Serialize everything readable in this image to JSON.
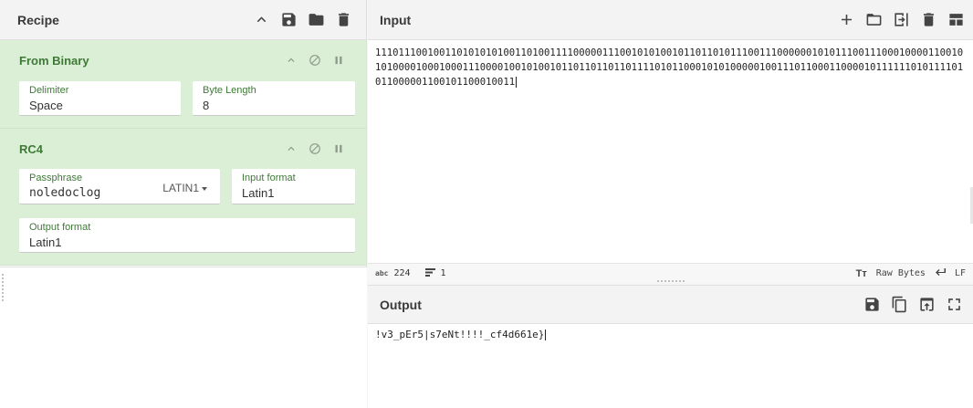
{
  "recipe": {
    "title": "Recipe",
    "header_icons": [
      "chevron-up-icon",
      "save-icon",
      "folder-icon",
      "trash-icon"
    ],
    "operations": [
      {
        "name": "From Binary",
        "controls": [
          "chevron-up-icon",
          "disable-icon",
          "pause-icon"
        ],
        "fields": [
          {
            "label": "Delimiter",
            "value": "Space"
          },
          {
            "label": "Byte Length",
            "value": "8"
          }
        ]
      },
      {
        "name": "RC4",
        "controls": [
          "chevron-up-icon",
          "disable-icon",
          "pause-icon"
        ],
        "fields": [
          {
            "label": "Passphrase",
            "value": "noledoclog",
            "dropdown": "LATIN1"
          },
          {
            "label": "Input format",
            "value": "Latin1"
          },
          {
            "label": "Output format",
            "value": "Latin1"
          }
        ]
      }
    ]
  },
  "input": {
    "title": "Input",
    "header_icons": [
      "plus-icon",
      "folder-icon",
      "import-icon",
      "trash-icon",
      "layout-icon"
    ],
    "text": "1110111001001101010101001101001111000001110010101001011011010111001110000001010111001110001000011001010100001000100011100001001010010110110110110111101011000101010000010011101100011000010111111010111101011000001100101100010011",
    "status": {
      "length_icon": "abc",
      "length": "224",
      "lines": "1",
      "raw_bytes": "Raw Bytes",
      "eol": "LF"
    }
  },
  "output": {
    "title": "Output",
    "header_icons": [
      "save-icon",
      "copy-icon",
      "replace-input-icon",
      "maximize-icon"
    ],
    "text": "!v3_pEr5|s7eNt!!!!_cf4d661e}"
  }
}
